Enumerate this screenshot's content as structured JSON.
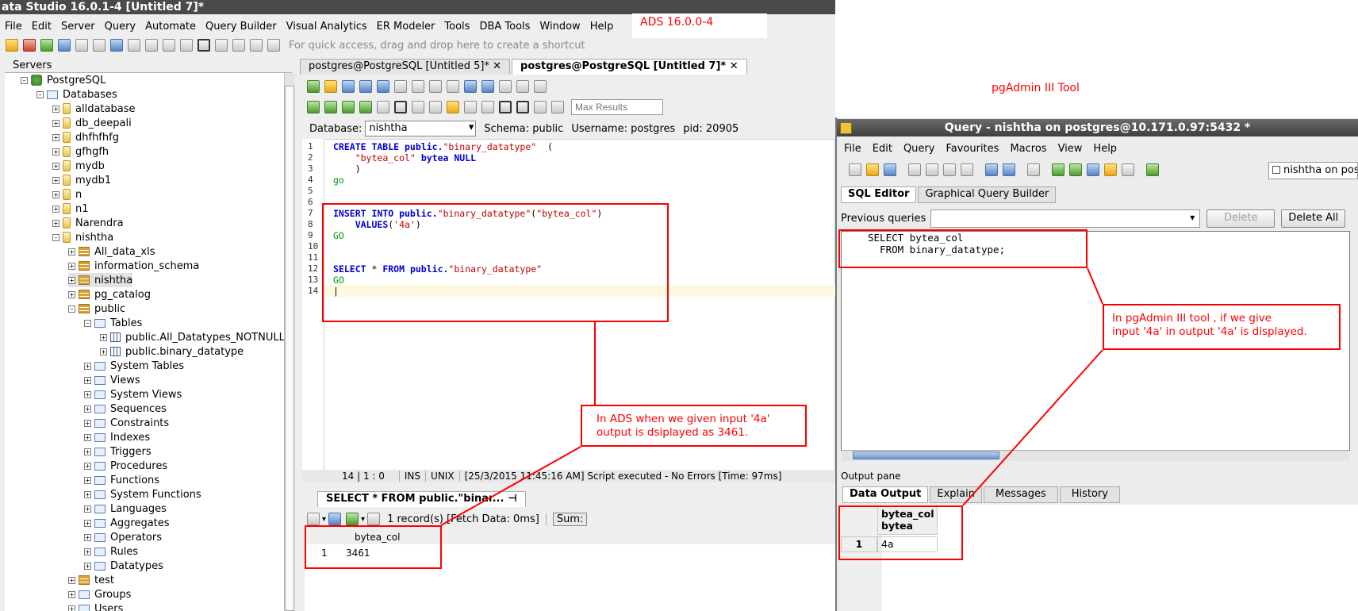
{
  "ads": {
    "title": "ata Studio 16.0.1-4 [Untitled 7]*",
    "menu": [
      "File",
      "Edit",
      "Server",
      "Query",
      "Automate",
      "Query Builder",
      "Visual Analytics",
      "ER Modeler",
      "Tools",
      "DBA Tools",
      "Window",
      "Help"
    ],
    "quick_access": "For quick access, drag and drop here to create a shortcut",
    "version_label": "ADS 16.0.0-4",
    "servers_label": "Servers",
    "tree": {
      "server": "PostgreSQL",
      "databases": "Databases",
      "db_items": [
        "alldatabase",
        "db_deepali",
        "dhfhfhfg",
        "gfhgfh",
        "mydb",
        "mydb1",
        "n",
        "n1",
        "Narendra",
        "nishtha"
      ],
      "schemas": [
        "All_data_xls",
        "information_schema",
        "nishtha",
        "pg_catalog",
        "public"
      ],
      "tables_label": "Tables",
      "tables": [
        "public.All_Datatypes_NOTNULL",
        "public.binary_datatype"
      ],
      "public_folders": [
        "System Tables",
        "Views",
        "System Views",
        "Sequences",
        "Constraints",
        "Indexes",
        "Triggers",
        "Procedures",
        "Functions",
        "System Functions",
        "Languages",
        "Aggregates",
        "Operators",
        "Rules",
        "Datatypes"
      ],
      "after": [
        "test",
        "Groups",
        "Users"
      ]
    },
    "tabs": [
      "postgres@PostgreSQL [Untitled 5]*",
      "postgres@PostgreSQL [Untitled 7]*"
    ],
    "max_results_placeholder": "Max Results",
    "database_label": "Database:",
    "database_value": "nishtha",
    "schema_text": "Schema:  public",
    "username_text": "Username:  postgres",
    "pid_text": "pid:  20905",
    "line_numbers": [
      "1",
      "2",
      "3",
      "4",
      "5",
      "6",
      "7",
      "8",
      "9",
      "10",
      "11",
      "12",
      "13",
      "14"
    ],
    "status": {
      "position": "14 | 1 : 0",
      "mode": "INS",
      "eol": "UNIX",
      "message": "[25/3/2015 11:45:16 AM] Script executed - No Errors [Time: 97ms]"
    },
    "result_tab": "SELECT * FROM public.\"binar...",
    "records_text": "1 record(s) [Fetch Data: 0ms]",
    "sum_label": "Sum:",
    "result_column": "bytea_col",
    "result_row_num": "1",
    "result_value": "3461"
  },
  "annotations": {
    "ads_note_line1": "In ADS when we given input '4a'",
    "ads_note_line2": "output is dsiplayed as 3461.",
    "pgadmin_label": "pgAdmin III Tool",
    "pg_note_line1": "In pgAdmin III tool , if we give",
    "pg_note_line2": "input '4a' in output '4a' is displayed."
  },
  "pgadmin": {
    "title": "Query - nishtha on postgres@10.171.0.97:5432 *",
    "menu": [
      "File",
      "Edit",
      "Query",
      "Favourites",
      "Macros",
      "View",
      "Help"
    ],
    "connection": "nishtha on postgres",
    "tabs": [
      "SQL Editor",
      "Graphical Query Builder"
    ],
    "previous_queries_label": "Previous queries",
    "delete_label": "Delete",
    "delete_all_label": "Delete All",
    "code_line1": "SELECT bytea_col",
    "code_line2": "  FROM binary_datatype;",
    "output_pane_label": "Output pane",
    "output_tabs": [
      "Data Output",
      "Explain",
      "Messages",
      "History"
    ],
    "col_name": "bytea_col",
    "col_type": "bytea",
    "row_num": "1",
    "row_value": "4a"
  }
}
